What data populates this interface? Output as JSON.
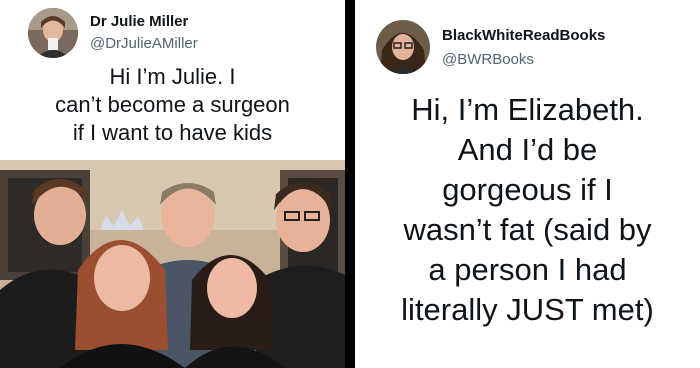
{
  "left_tweet": {
    "display_name": "Dr Julie Miller",
    "handle": "@DrJulieAMiller",
    "text_lines": [
      "Hi I’m Julie. I",
      "can’t become a surgeon",
      "if I want to have kids"
    ]
  },
  "right_tweet": {
    "display_name": "BlackWhiteReadBooks",
    "handle": "@BWRBooks",
    "text_lines": [
      "Hi, I’m Elizabeth.",
      "And I’d be",
      "gorgeous if I",
      "wasn’t fat (said by",
      "a person I had",
      "literally JUST met)"
    ]
  }
}
